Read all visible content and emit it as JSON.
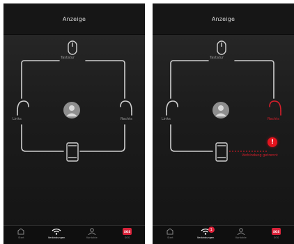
{
  "colors": {
    "accent": "#d9233a",
    "alert": "#e4141e",
    "line": "#cfcfcf"
  },
  "screens": [
    {
      "title": "Anzeige",
      "labels": {
        "top": "Tastatur",
        "left": "Links",
        "right": "Rechts"
      },
      "tabbar": {
        "tabs": [
          {
            "label": "Start",
            "icon": "home-icon"
          },
          {
            "label": "Verbindungen",
            "icon": "wifi-icon"
          },
          {
            "label": "Kontakte",
            "icon": "person-icon"
          },
          {
            "label": "SOS",
            "icon": "sos-icon",
            "badge": "SOS"
          }
        ]
      }
    },
    {
      "title": "Anzeige",
      "labels": {
        "top": "Tastatur",
        "left": "Links",
        "right": "Rechts",
        "alert": "Verbindung getrennt"
      },
      "tabbar": {
        "tabs": [
          {
            "label": "Start",
            "icon": "home-icon"
          },
          {
            "label": "Verbindungen",
            "icon": "wifi-icon",
            "badge": "1"
          },
          {
            "label": "Kontakte",
            "icon": "person-icon"
          },
          {
            "label": "SOS",
            "icon": "sos-icon",
            "badge": "SOS"
          }
        ]
      }
    }
  ]
}
